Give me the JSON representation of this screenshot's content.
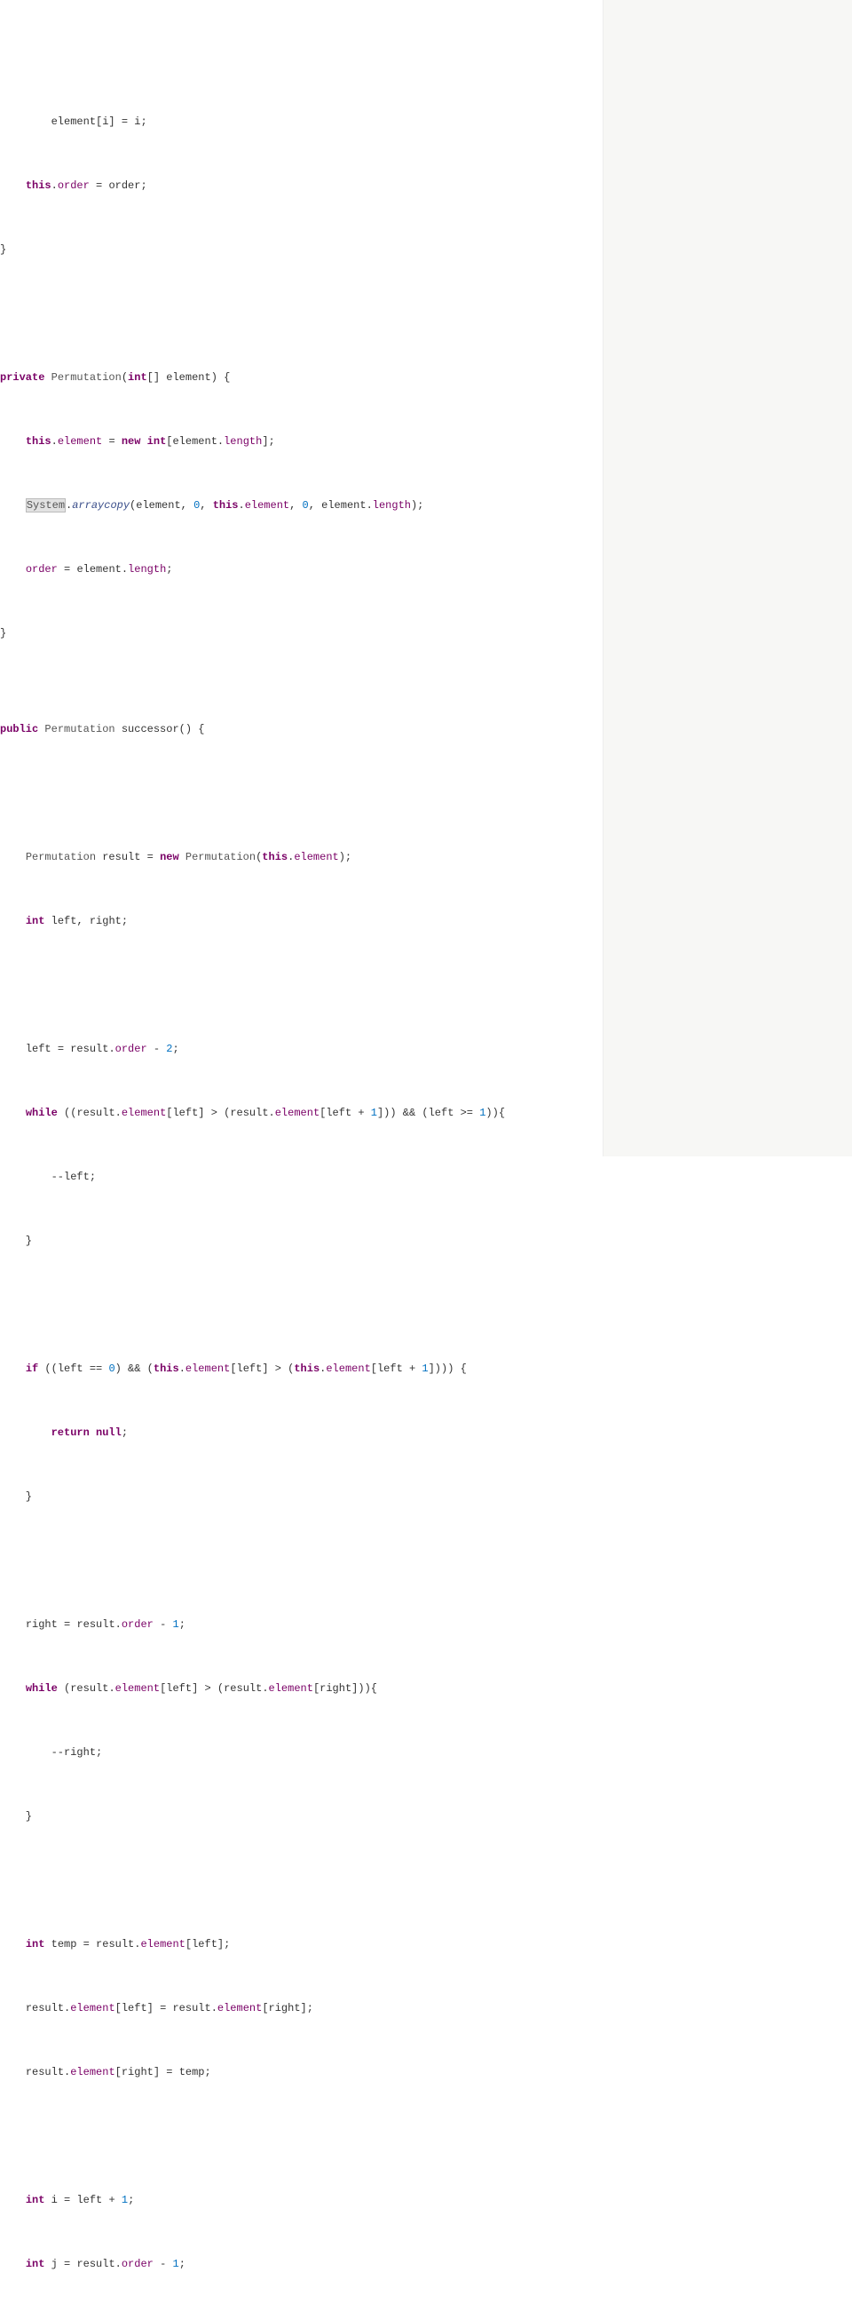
{
  "code": {
    "kw_private": "private",
    "kw_public": "public",
    "kw_this": "this",
    "kw_new": "new",
    "kw_int": "int",
    "kw_while": "while",
    "kw_if": "if",
    "kw_return": "return",
    "kw_null": "null",
    "cls_Permutation": "Permutation",
    "cls_System": "System",
    "mth_arraycopy": "arraycopy",
    "mth_successor": "successor",
    "fld_element": "element",
    "fld_order": "order",
    "fld_length": "length",
    "id_element": "element",
    "id_order": "order",
    "id_result": "result",
    "id_left": "left",
    "id_right": "right",
    "id_temp": "temp",
    "id_i": "i",
    "id_j": "j",
    "num_0": "0",
    "num_1": "1",
    "num_2": "2"
  }
}
